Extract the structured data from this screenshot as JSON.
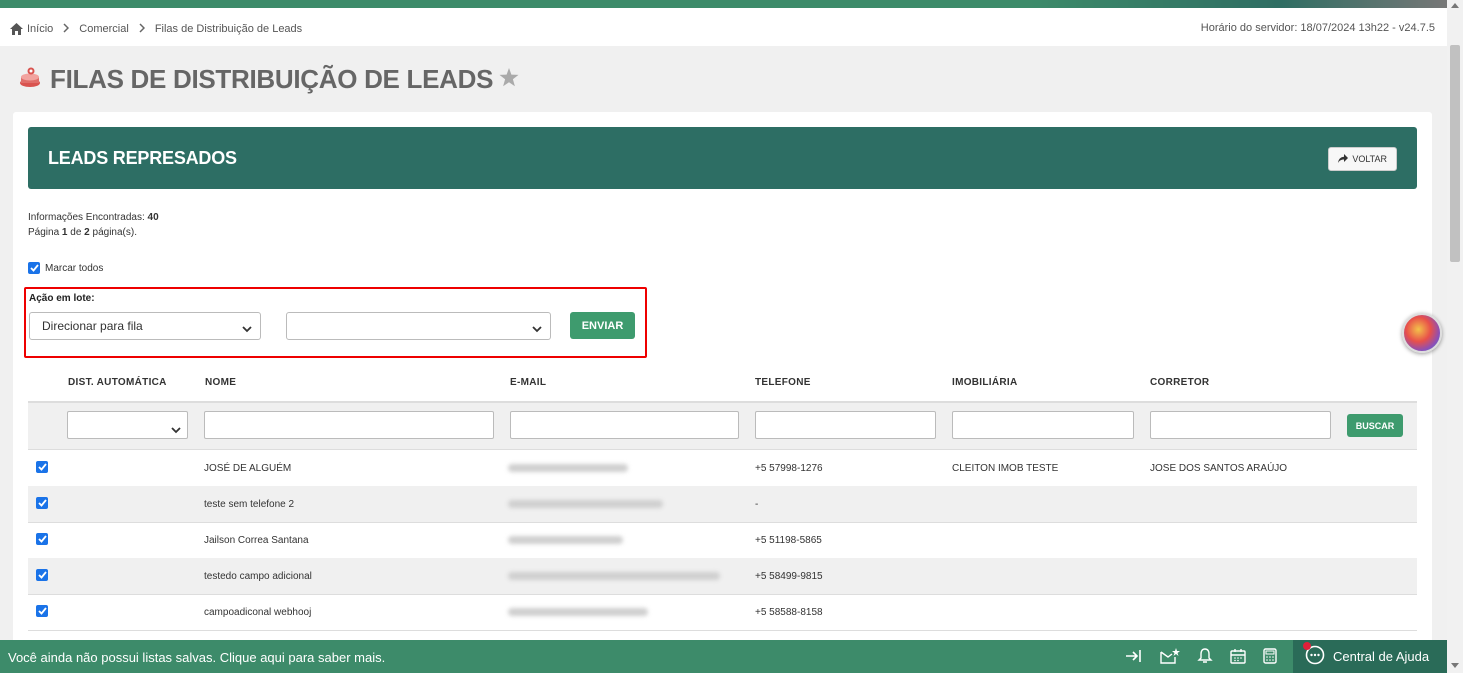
{
  "breadcrumb": {
    "items": [
      "Início",
      "Comercial",
      "Filas de Distribuição de Leads"
    ],
    "server_time": "Horário do servidor: 18/07/2024 13h22 - v24.7.5"
  },
  "page": {
    "title": "FILAS DE DISTRIBUIÇÃO DE LEADS"
  },
  "card": {
    "header_title": "LEADS REPRESADOS",
    "back_label": "VOLTAR"
  },
  "info": {
    "found_label": "Informações Encontradas:",
    "found_count": "40",
    "page_prefix": "Página",
    "page_current": "1",
    "page_of": "de",
    "page_total": "2",
    "page_suffix": "página(s)."
  },
  "mark_all_label": "Marcar todos",
  "batch": {
    "label": "Ação em lote:",
    "action_value": "Direcionar para fila",
    "target_value": "",
    "submit_label": "ENVIAR"
  },
  "table": {
    "columns": [
      "DIST. AUTOMÁTICA",
      "NOME",
      "E-MAIL",
      "TELEFONE",
      "IMOBILIÁRIA",
      "CORRETOR"
    ],
    "search_label": "BUSCAR",
    "rows": [
      {
        "name": "JOSÉ DE ALGUÉM",
        "phone": "+5 57998-1276",
        "agency": "CLEITON IMOB TESTE",
        "broker": "JOSE DOS SANTOS ARAÚJO"
      },
      {
        "name": "teste sem telefone 2",
        "phone": "-",
        "agency": "",
        "broker": ""
      },
      {
        "name": "Jailson Correa Santana",
        "phone": "+5 51198-5865",
        "agency": "",
        "broker": ""
      },
      {
        "name": "testedo campo adicional",
        "phone": "+5 58499-9815",
        "agency": "",
        "broker": ""
      },
      {
        "name": "campoadiconal webhooj",
        "phone": "+5 58588-8158",
        "agency": "",
        "broker": ""
      }
    ]
  },
  "bottom_bar": {
    "message": "Você ainda não possui listas salvas. Clique aqui para saber mais.",
    "help_label": "Central de Ajuda"
  },
  "colors": {
    "accent": "#3d8b6a",
    "header": "#2d6e64",
    "button": "#3e9b6e",
    "highlight_border": "#ee0000"
  }
}
